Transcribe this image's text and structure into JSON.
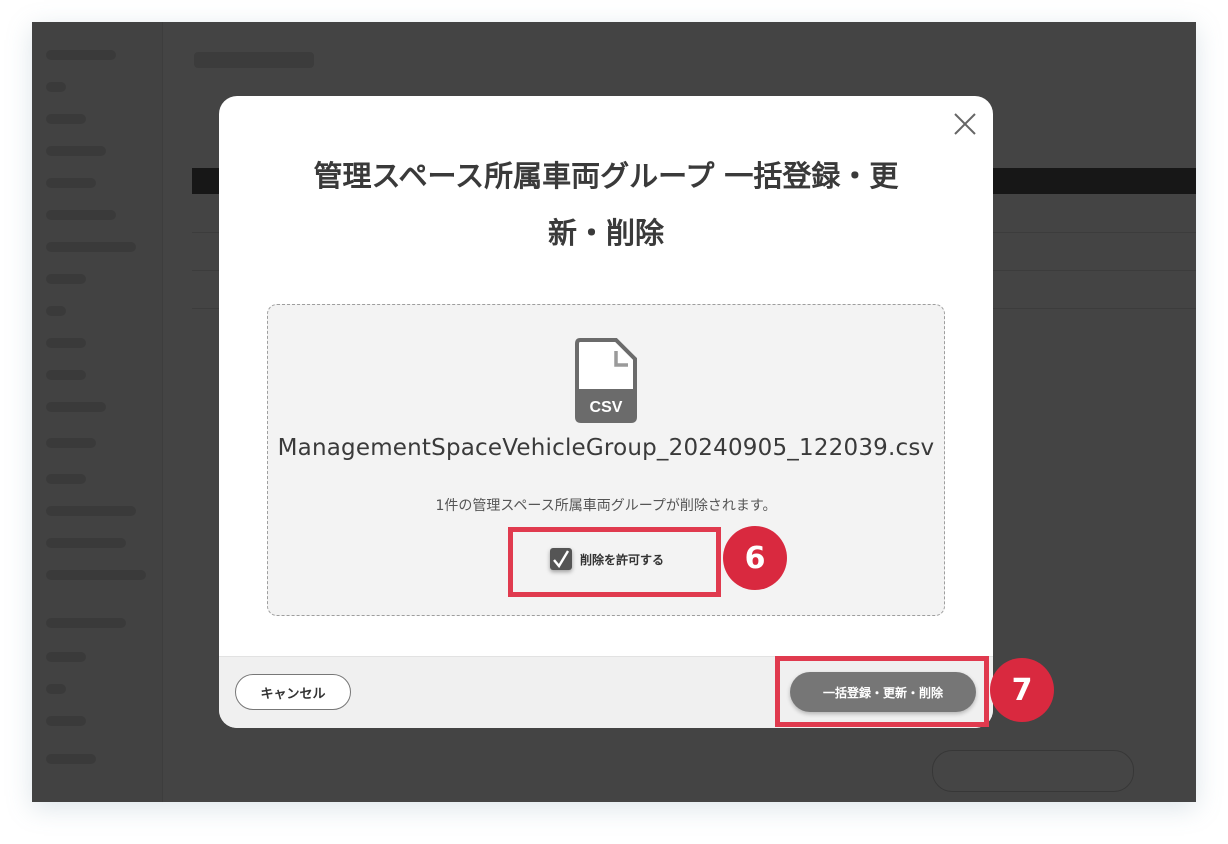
{
  "modal": {
    "title_line1": "管理スペース所属車両グループ 一括登録・更",
    "title_line2": "新・削除",
    "file_icon_label": "CSV",
    "file_name": "ManagementSpaceVehicleGroup_20240905_122039.csv",
    "delete_message": "1件の管理スペース所属車両グループが削除されます。",
    "allow_delete_label": "削除を許可する",
    "allow_delete_checked": true,
    "close_icon": "close-icon"
  },
  "footer": {
    "cancel_label": "キャンセル",
    "submit_label": "一括登録・更新・削除"
  },
  "annotations": {
    "step6": "6",
    "step7": "7",
    "highlight_color": "#e03a4e",
    "badge_color": "#d9293f"
  }
}
